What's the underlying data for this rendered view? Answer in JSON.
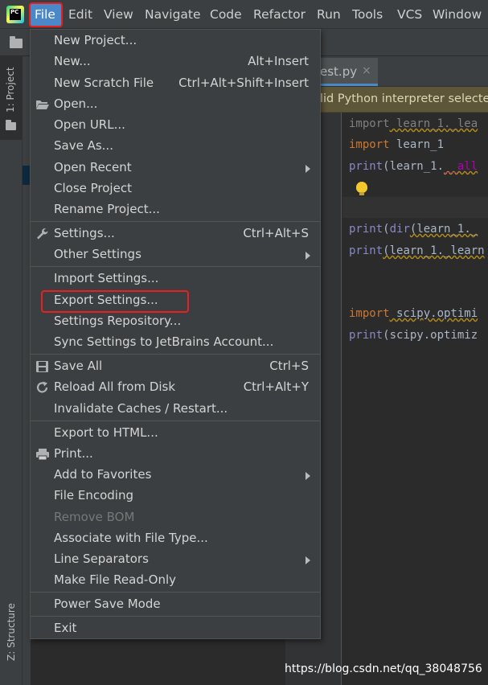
{
  "menubar": {
    "logo_text": "PC",
    "items": [
      "File",
      "Edit",
      "View",
      "Navigate",
      "Code",
      "Refactor",
      "Run",
      "Tools",
      "VCS",
      "Window"
    ]
  },
  "left_strip": {
    "project_tab": "1: Project",
    "structure_tab": "Z: Structure"
  },
  "editor": {
    "tab_label": "est.py",
    "tab_close": "×",
    "notice": "lid Python interpreter selecte",
    "lines": {
      "l1_kw": "import",
      "l1_rest": " learn_1._lea",
      "l2_kw": "import",
      "l2_rest": " learn_1",
      "l3_fn": "print",
      "l3_a": "(learn_1.",
      "l3_b": "__all",
      "l4_fn": "print",
      "l4_a": "(",
      "l4_b": "dir",
      "l4_c": "(learn_1._",
      "l5_fn": "print",
      "l5_a": "(learn_1._learn",
      "l6_kw": "import",
      "l6_rest": " scipy.optimi",
      "l7_fn": "print",
      "l7_a": "(scipy.optimiz"
    }
  },
  "file_menu": {
    "new_project": "New Project...",
    "new": "New...",
    "new_sc": "Alt+Insert",
    "new_scratch": "New Scratch File",
    "new_scratch_sc": "Ctrl+Alt+Shift+Insert",
    "open": "Open...",
    "open_url": "Open URL...",
    "save_as": "Save As...",
    "open_recent": "Open Recent",
    "close_project": "Close Project",
    "rename_project": "Rename Project...",
    "settings": "Settings...",
    "settings_sc": "Ctrl+Alt+S",
    "other_settings": "Other Settings",
    "import_settings": "Import Settings...",
    "export_settings": "Export Settings...",
    "settings_repository": "Settings Repository...",
    "sync_settings": "Sync Settings to JetBrains Account...",
    "save_all": "Save All",
    "save_all_sc": "Ctrl+S",
    "reload_all": "Reload All from Disk",
    "reload_all_sc": "Ctrl+Alt+Y",
    "invalidate_caches": "Invalidate Caches / Restart...",
    "export_html": "Export to HTML...",
    "print": "Print...",
    "add_favorites": "Add to Favorites",
    "file_encoding": "File Encoding",
    "remove_bom": "Remove BOM",
    "associate_file_type": "Associate with File Type...",
    "line_separators": "Line Separators",
    "make_read_only": "Make File Read-Only",
    "power_save": "Power Save Mode",
    "exit": "Exit"
  },
  "watermark": "https://blog.csdn.net/qq_38048756",
  "colors": {
    "accent": "#4a88c7",
    "highlight_box": "#e82020",
    "menu_bg": "#3c3f41",
    "editor_bg": "#2b2b2b"
  }
}
